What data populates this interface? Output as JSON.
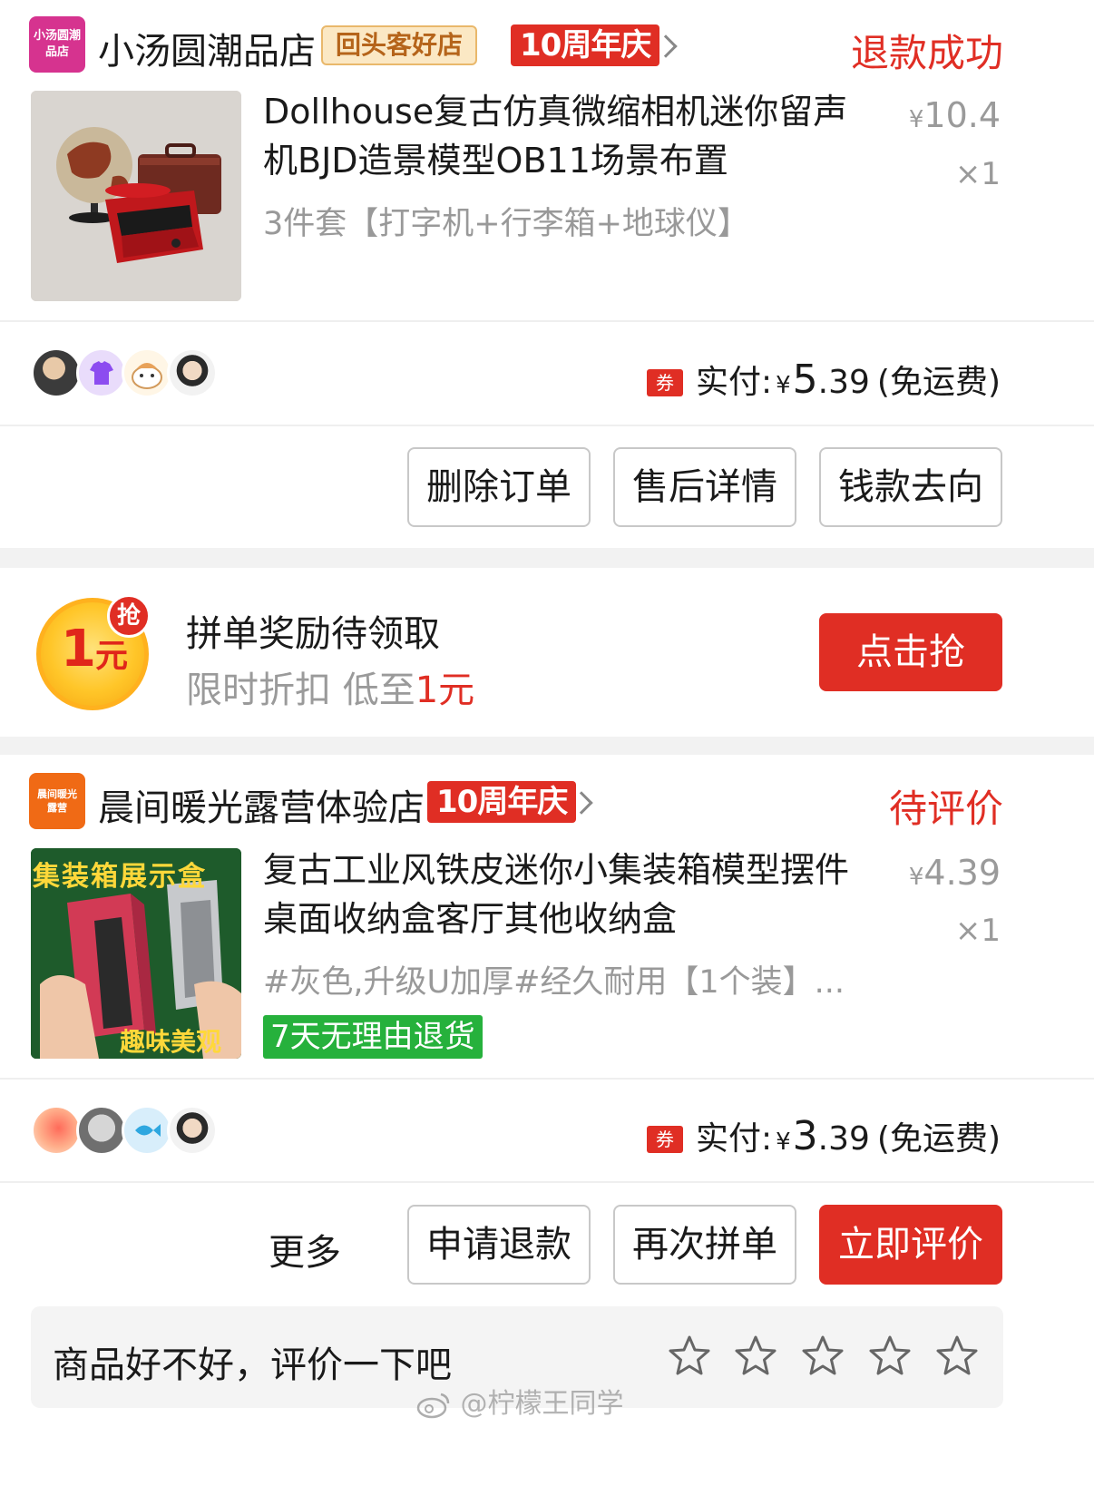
{
  "orders": [
    {
      "shop": {
        "logo_text": "小汤圆潮品店",
        "name": "小汤圆潮品店",
        "badge_return": "回头客好店",
        "badge_anniversary": "10周年庆"
      },
      "status": "退款成功",
      "product": {
        "title": "Dollhouse复古仿真微缩相机迷你留声机BJD造景模型OB11场景布置",
        "spec": "3件套【打字机+行李箱+地球仪】",
        "price_symbol": "¥",
        "price": "10.4",
        "qty": "×1"
      },
      "payment": {
        "coupon": "券",
        "label": "实付:",
        "symbol": "¥",
        "amount_int": "5",
        "amount_dec": ".39",
        "shipping": "(免运费)"
      },
      "buttons": [
        "删除订单",
        "售后详情",
        "钱款去向"
      ]
    },
    {
      "shop": {
        "logo_text": "晨间暖光露营",
        "name": "晨间暖光露营体验店",
        "badge_anniversary": "10周年庆"
      },
      "status": "待评价",
      "product": {
        "title": "复古工业风铁皮迷你小集装箱模型摆件桌面收纳盒客厅其他收纳盒",
        "spec": "#灰色,升级U加厚#经久耐用【1个装】...",
        "tag": "7天无理由退货",
        "image_text_top": "集装箱展示盒",
        "image_text_bottom": "趣味美观",
        "price_symbol": "¥",
        "price": "4.39",
        "qty": "×1"
      },
      "payment": {
        "coupon": "券",
        "label": "实付:",
        "symbol": "¥",
        "amount_int": "3",
        "amount_dec": ".39",
        "shipping": "(免运费)"
      },
      "more": "更多",
      "buttons": [
        "申请退款",
        "再次拼单",
        "立即评价"
      ]
    }
  ],
  "reward": {
    "coin_number": "1",
    "coin_unit": "元",
    "grab_badge": "抢",
    "title": "拼单奖励待领取",
    "subtitle_prefix": "限时折扣 低至",
    "subtitle_highlight": "1元",
    "button": "点击抢"
  },
  "review": {
    "prompt": "商品好不好，评价一下吧",
    "stars": 5
  },
  "watermark": "@柠檬王同学",
  "colors": {
    "accent": "#e02e24",
    "green_tag": "#26b13c",
    "gold": "#ffc629"
  },
  "icons": [
    "chevron-right-icon",
    "coupon-icon",
    "star-outline-icon",
    "weibo-icon"
  ]
}
